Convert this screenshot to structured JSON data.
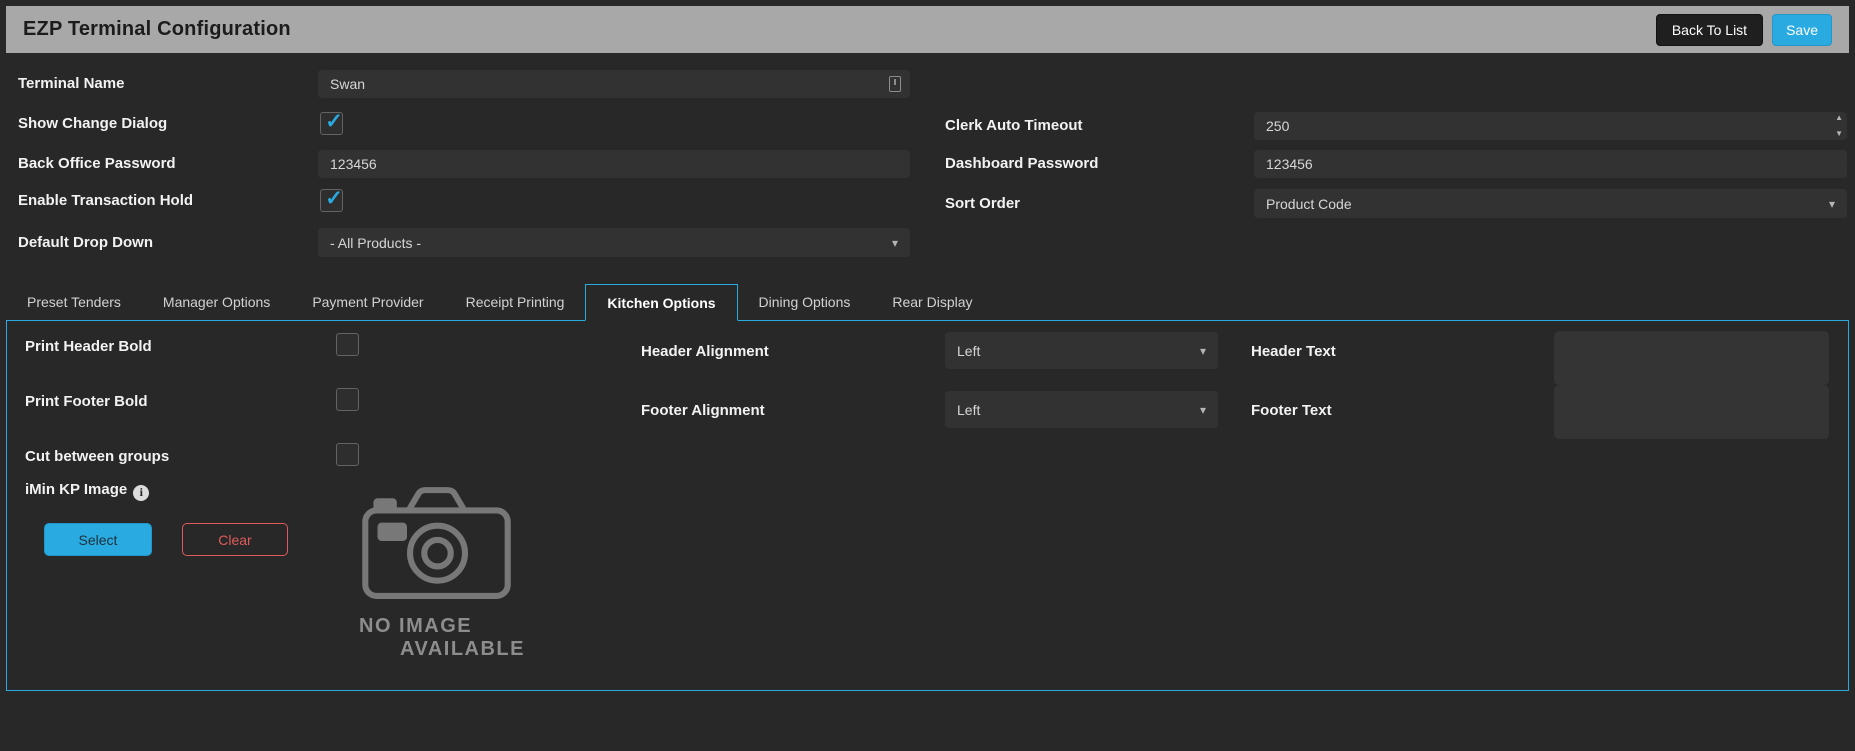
{
  "page": {
    "title": "EZP Terminal Configuration"
  },
  "topbar": {
    "back_label": "Back To List",
    "save_label": "Save"
  },
  "form": {
    "terminal_name": {
      "label": "Terminal Name",
      "value": "Swan"
    },
    "show_change_dialog": {
      "label": "Show Change Dialog",
      "checked": true,
      "check": "✓"
    },
    "back_office_password": {
      "label": "Back Office Password",
      "value": "123456"
    },
    "enable_transaction_hold": {
      "label": "Enable Transaction Hold",
      "checked": true,
      "check": "✓"
    },
    "default_drop_down": {
      "label": "Default Drop Down",
      "value": "- All Products -"
    },
    "clerk_auto_timeout": {
      "label": "Clerk Auto Timeout",
      "value": "250"
    },
    "dashboard_password": {
      "label": "Dashboard Password",
      "value": "123456"
    },
    "sort_order": {
      "label": "Sort Order",
      "value": "Product Code"
    }
  },
  "tabs": {
    "items": [
      "Preset Tenders",
      "Manager Options",
      "Payment Provider",
      "Receipt Printing",
      "Kitchen Options",
      "Dining Options",
      "Rear Display"
    ],
    "active": "Kitchen Options"
  },
  "kitchen": {
    "print_header_bold": {
      "label": "Print Header Bold",
      "checked": false
    },
    "print_footer_bold": {
      "label": "Print Footer Bold",
      "checked": false
    },
    "cut_between_groups": {
      "label": "Cut between groups",
      "checked": false
    },
    "imin_kp_image": {
      "label": "iMin KP Image"
    },
    "select_label": "Select",
    "clear_label": "Clear",
    "no_image": {
      "line1": "NO IMAGE",
      "line2": "AVAILABLE"
    },
    "header_alignment": {
      "label": "Header Alignment",
      "value": "Left"
    },
    "footer_alignment": {
      "label": "Footer Alignment",
      "value": "Left"
    },
    "header_text": {
      "label": "Header Text",
      "value": ""
    },
    "footer_text": {
      "label": "Footer Text",
      "value": ""
    }
  },
  "icons": {
    "caret_down": "▾",
    "spinner_up": "▲",
    "spinner_down": "▼",
    "check": "✓",
    "info": "i"
  },
  "colors": {
    "accent": "#29abe2",
    "danger": "#e05b5b",
    "topbar_bg": "#a8a8a8",
    "page_bg": "#282828"
  }
}
